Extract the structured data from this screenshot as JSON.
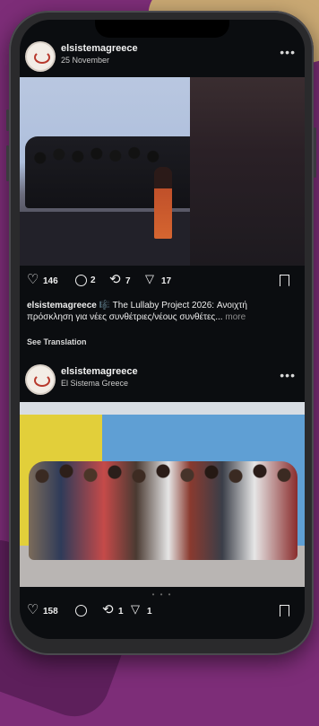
{
  "posts": [
    {
      "username": "elsistemagreece",
      "subline": "25 November",
      "more_icon": "more-horizontal-icon",
      "likes": "146",
      "comments": "2",
      "reposts": "7",
      "shares": "17",
      "caption_user": "elsistemagreece",
      "caption_text": "🎼 The Lullaby Project 2026: Ανοιχτή πρόσκληση για νέες συνθέτριες/νέους συνθέτες...",
      "caption_more": "more",
      "see_translation": "See Translation"
    },
    {
      "username": "elsistemagreece",
      "subline": "El Sistema Greece",
      "more_icon": "more-horizontal-icon",
      "likes": "158",
      "comments": "",
      "reposts": "1",
      "shares": "1",
      "carousel_dots": "• • •"
    }
  ],
  "icons": [
    "heart-icon",
    "comment-icon",
    "repost-icon",
    "share-icon",
    "bookmark-icon"
  ],
  "colors": {
    "background": "#7d2d78",
    "screen": "#0b0d10",
    "text": "#eeeeee"
  }
}
